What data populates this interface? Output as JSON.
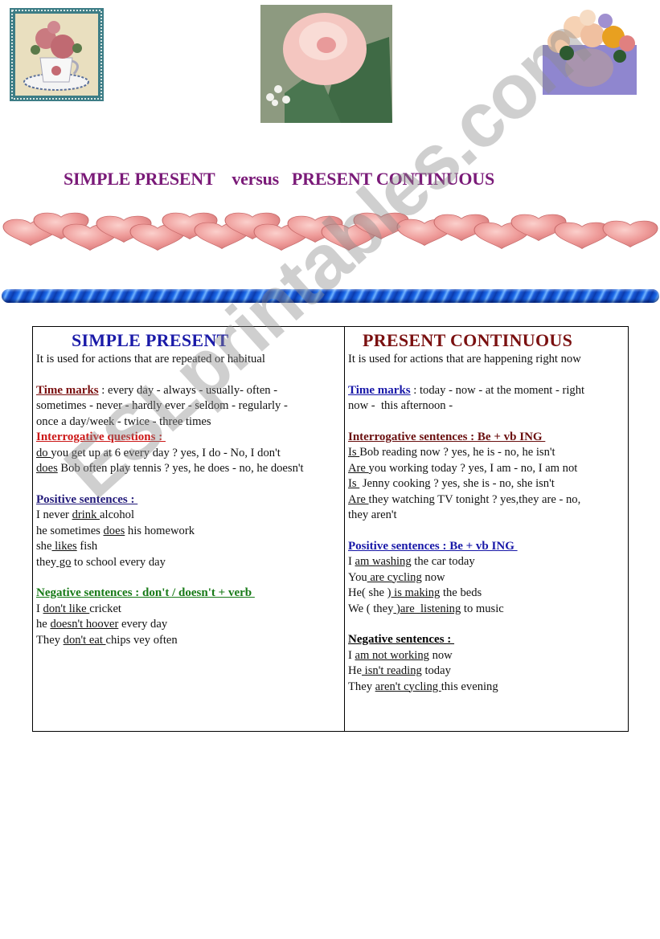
{
  "images": [
    {
      "name": "teacup-roses-picture",
      "alt": "pink roses in a teacup"
    },
    {
      "name": "pink-rose-picture",
      "alt": "pink rose painting"
    },
    {
      "name": "rose-bouquet-picture",
      "alt": "rose bouquet in glass vase"
    }
  ],
  "title": "SIMPLE PRESENT    versus   PRESENT CONTINUOUS",
  "colors": {
    "title": "#7a1a78",
    "simple_present_head": "#1a1aa8",
    "present_continuous_head": "#7a1010",
    "red_section": "#cc1818",
    "navy_section": "#221a7a",
    "green_section": "#177a17",
    "maroon_section": "#6a0f0f",
    "blue_section": "#1818a8",
    "black_section": "#000000",
    "hearts": "#f0a0a0",
    "rope": "#1c6ae8"
  },
  "watermark": "ESLprintables.com",
  "simple_present": {
    "heading": "SIMPLE  PRESENT",
    "usage": "It is used for actions that are repeated or habitual",
    "time_marks_label": "Time marks",
    "time_marks_lines": [
      " : every day - always - usually- often -",
      "sometimes - never - hardly ever - seldom - regularly -",
      "once a day/week - twice - three times"
    ],
    "interrogative": {
      "title": "Interrogative questions : ",
      "rows": [
        {
          "aux": "do ",
          "rest": "you get up at 6 every day ? yes, I do - No, I don't"
        },
        {
          "aux": "does",
          "rest": " Bob often play tennis ? yes, he does - no, he doesn't"
        }
      ]
    },
    "positive": {
      "title": "Positive sentences : ",
      "rows": [
        {
          "pre": "I never ",
          "verb": "drink ",
          "post": "alcohol"
        },
        {
          "pre": "he sometimes ",
          "verb": "does",
          "post": " his homework"
        },
        {
          "pre": "she",
          "verb": " likes",
          "post": " fish"
        },
        {
          "pre": "they",
          "verb": " go",
          "post": " to school every day"
        }
      ]
    },
    "negative": {
      "title": "Negative sentences : don't / doesn't + verb ",
      "rows": [
        {
          "pre": "I ",
          "verb": "don't like ",
          "post": "cricket"
        },
        {
          "pre": "he ",
          "verb": "doesn't hoover",
          "post": " every day"
        },
        {
          "pre": "They ",
          "verb": "don't eat ",
          "post": "chips vey often"
        }
      ]
    }
  },
  "present_continuous": {
    "heading": "PRESENT  CONTINUOUS",
    "usage": "It is used for actions that are happening right now",
    "time_marks_label": "Time marks",
    "time_marks_lines": [
      " : today - now - at the moment - right",
      "now -  this afternoon -"
    ],
    "interrogative": {
      "title": "Interrogative sentences : Be + vb ING ",
      "rows": [
        {
          "aux": "Is ",
          "rest": "Bob reading now ? yes, he is - no, he isn't"
        },
        {
          "aux": "Are ",
          "rest": "you working today ? yes, I am - no, I am not"
        },
        {
          "aux": "Is ",
          "rest": " Jenny cooking ? yes, she is - no, she isn't"
        },
        {
          "aux": "Are ",
          "rest": "they watching TV tonight ? yes,they are - no,"
        }
      ],
      "continuation": "they aren't"
    },
    "positive": {
      "title": "Positive sentences : Be + vb ING ",
      "rows": [
        {
          "pre": "I ",
          "verb": "am washing",
          "post": " the car today"
        },
        {
          "pre": "You",
          "verb": " are cycling",
          "post": " now"
        },
        {
          "pre": "He( she )",
          "verb": " is making",
          "post": " the beds"
        },
        {
          "pre": "We ( they",
          "verb": " )are  listening",
          "post": " to music"
        }
      ]
    },
    "negative": {
      "title": "Negative sentences : ",
      "rows": [
        {
          "pre": "I ",
          "verb": "am not working",
          "post": " now"
        },
        {
          "pre": "He",
          "verb": " isn't reading",
          "post": " today"
        },
        {
          "pre": "They ",
          "verb": "aren't cycling ",
          "post": "this evening"
        }
      ]
    }
  }
}
